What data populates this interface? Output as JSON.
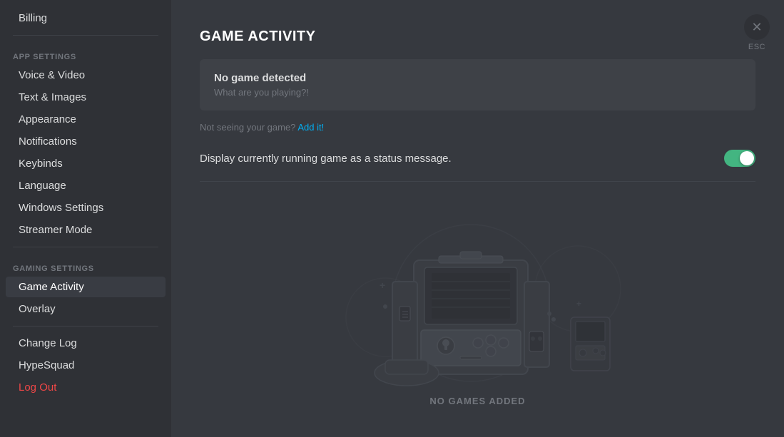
{
  "sidebar": {
    "app_settings_label": "APP SETTINGS",
    "gaming_settings_label": "GAMING SETTINGS",
    "items_top": [
      {
        "label": "Billing",
        "id": "billing",
        "active": false,
        "danger": false
      },
      {
        "label": "Voice & Video",
        "id": "voice-video",
        "active": false,
        "danger": false
      },
      {
        "label": "Text & Images",
        "id": "text-images",
        "active": false,
        "danger": false
      },
      {
        "label": "Appearance",
        "id": "appearance",
        "active": false,
        "danger": false
      },
      {
        "label": "Notifications",
        "id": "notifications",
        "active": false,
        "danger": false
      },
      {
        "label": "Keybinds",
        "id": "keybinds",
        "active": false,
        "danger": false
      },
      {
        "label": "Language",
        "id": "language",
        "active": false,
        "danger": false
      },
      {
        "label": "Windows Settings",
        "id": "windows-settings",
        "active": false,
        "danger": false
      },
      {
        "label": "Streamer Mode",
        "id": "streamer-mode",
        "active": false,
        "danger": false
      }
    ],
    "items_gaming": [
      {
        "label": "Game Activity",
        "id": "game-activity",
        "active": true,
        "danger": false
      },
      {
        "label": "Overlay",
        "id": "overlay",
        "active": false,
        "danger": false
      }
    ],
    "items_bottom": [
      {
        "label": "Change Log",
        "id": "change-log",
        "active": false,
        "danger": false
      },
      {
        "label": "HypeSquad",
        "id": "hypesquad",
        "active": false,
        "danger": false
      },
      {
        "label": "Log Out",
        "id": "log-out",
        "active": false,
        "danger": true
      }
    ]
  },
  "main": {
    "page_title": "GAME ACTIVITY",
    "no_game_title": "No game detected",
    "no_game_subtitle": "What are you playing?!",
    "not_seeing_text": "Not seeing your game?",
    "add_it_label": "Add it!",
    "toggle_label": "Display currently running game as a status message.",
    "toggle_on": true,
    "no_games_label": "NO GAMES ADDED",
    "close_label": "✕",
    "esc_label": "ESC"
  }
}
